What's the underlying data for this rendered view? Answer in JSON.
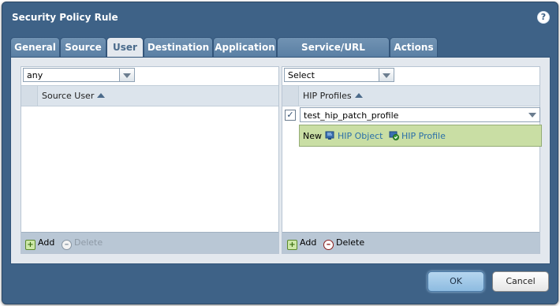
{
  "dialog": {
    "title": "Security Policy Rule",
    "help_label": "?"
  },
  "tabs": [
    {
      "label": "General"
    },
    {
      "label": "Source"
    },
    {
      "label": "User",
      "active": true
    },
    {
      "label": "Destination"
    },
    {
      "label": "Application"
    },
    {
      "label": "Service/URL Category"
    },
    {
      "label": "Actions"
    }
  ],
  "left_panel": {
    "select_value": "any",
    "column_header": "Source User",
    "footer": {
      "add_label": "Add",
      "delete_label": "Delete"
    }
  },
  "right_panel": {
    "select_value": "Select",
    "column_header": "HIP Profiles",
    "row": {
      "checked": true,
      "value": "test_hip_patch_profile"
    },
    "dropdown": {
      "new_label": "New",
      "hip_object_label": "HIP Object",
      "hip_profile_label": "HIP Profile"
    },
    "footer": {
      "add_label": "Add",
      "delete_label": "Delete"
    }
  },
  "buttons": {
    "ok": "OK",
    "cancel": "Cancel"
  },
  "colors": {
    "dialog_bg": "#3e6287",
    "content_bg": "#e3e8ee",
    "dropdown_bg": "#c9dea4",
    "link": "#2a6fa8"
  },
  "icons": {
    "help": "help-icon",
    "sort": "sort-asc-icon",
    "add": "plus-icon",
    "delete": "minus-icon",
    "hip_object": "hip-object-icon",
    "hip_profile": "hip-profile-icon"
  }
}
